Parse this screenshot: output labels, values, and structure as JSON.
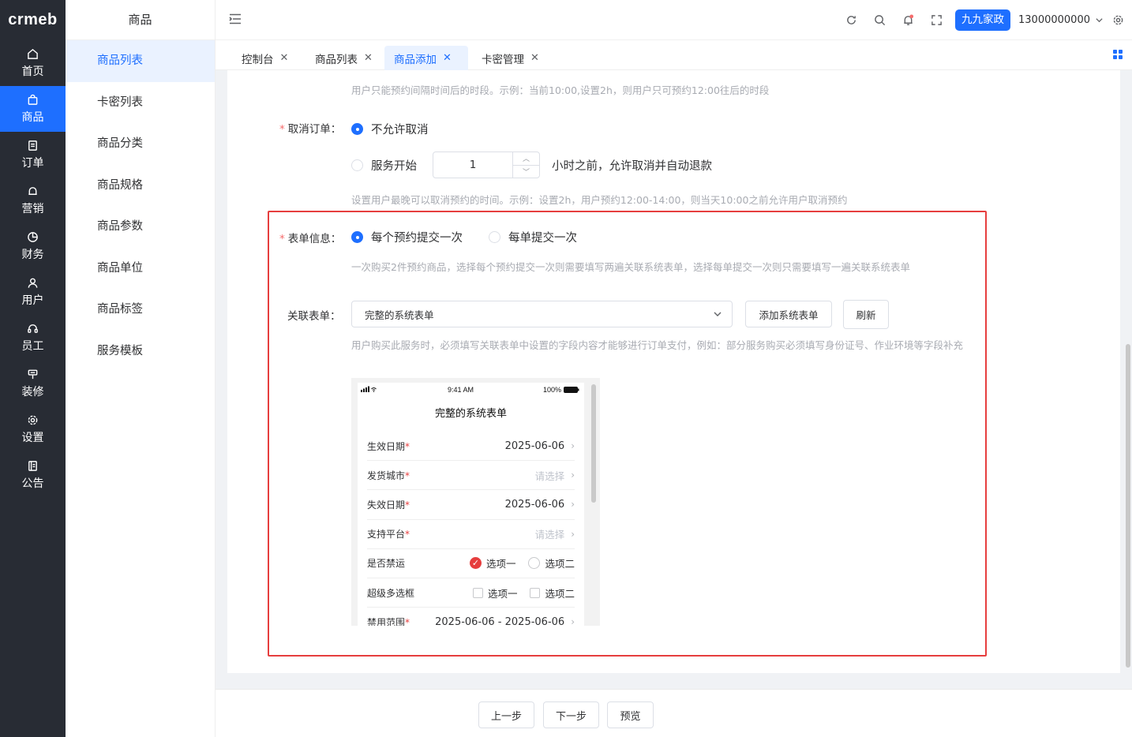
{
  "app": {
    "logo": "crmeb"
  },
  "rail": [
    {
      "label": "首页",
      "icon": "home-icon"
    },
    {
      "label": "商品",
      "icon": "bag-icon",
      "active": true
    },
    {
      "label": "订单",
      "icon": "order-icon"
    },
    {
      "label": "营销",
      "icon": "bell-icon"
    },
    {
      "label": "财务",
      "icon": "pie-icon"
    },
    {
      "label": "用户",
      "icon": "user-icon"
    },
    {
      "label": "员工",
      "icon": "headset-icon"
    },
    {
      "label": "装修",
      "icon": "brush-icon"
    },
    {
      "label": "设置",
      "icon": "gear-icon"
    },
    {
      "label": "公告",
      "icon": "notice-icon"
    }
  ],
  "subbar": {
    "title": "商品",
    "items": [
      "商品列表",
      "卡密列表",
      "商品分类",
      "商品规格",
      "商品参数",
      "商品单位",
      "商品标签",
      "服务模板"
    ]
  },
  "header": {
    "org": "九九家政",
    "phone": "13000000000"
  },
  "tabs": [
    {
      "label": "控制台"
    },
    {
      "label": "商品列表"
    },
    {
      "label": "商品添加",
      "active": true
    },
    {
      "label": "卡密管理"
    }
  ],
  "form": {
    "top_hint": "用户只能预约间隔时间后的时段。示例：当前10:00,设置2h，则用户只可预约12:00往后的时段",
    "cancel": {
      "label": "取消订单：",
      "opt1": "不允许取消",
      "opt2": "服务开始",
      "hours": "1",
      "suffix": "小时之前，允许取消并自动退款",
      "hint": "设置用户最晚可以取消预约的时间。示例：设置2h，用户预约12:00-14:00，则当天10:00之前允许用户取消预约"
    },
    "form_info": {
      "label": "表单信息：",
      "opt1": "每个预约提交一次",
      "opt2": "每单提交一次",
      "hint": "一次购买2件预约商品，选择每个预约提交一次则需要填写两遍关联系统表单，选择每单提交一次则只需要填写一遍关联系统表单"
    },
    "linked_form": {
      "label": "关联表单：",
      "value": "完整的系统表单",
      "add_btn": "添加系统表单",
      "refresh_btn": "刷新",
      "hint": "用户购买此服务时，必须填写关联表单中设置的字段内容才能够进行订单支付，例如：部分服务购买必须填写身份证号、作业环境等字段补充"
    }
  },
  "preview": {
    "status_time": "9:41 AM",
    "battery": "100%",
    "title": "完整的系统表单",
    "rows": [
      {
        "label": "生效日期",
        "required": true,
        "value": "2025-06-06"
      },
      {
        "label": "发货城市",
        "required": true,
        "placeholder": "请选择"
      },
      {
        "label": "失效日期",
        "required": true,
        "value": "2025-06-06"
      },
      {
        "label": "支持平台",
        "required": true,
        "placeholder": "请选择"
      }
    ],
    "radio_row": {
      "label": "是否禁运",
      "opt1": "选项一",
      "opt2": "选项二"
    },
    "check_row": {
      "label": "超级多选框",
      "opt1": "选项一",
      "opt2": "选项二"
    },
    "range_row": {
      "label": "禁用范围",
      "required": true,
      "value": "2025-06-06 - 2025-06-06"
    }
  },
  "footer": {
    "prev": "上一步",
    "next": "下一步",
    "preview": "预览"
  }
}
